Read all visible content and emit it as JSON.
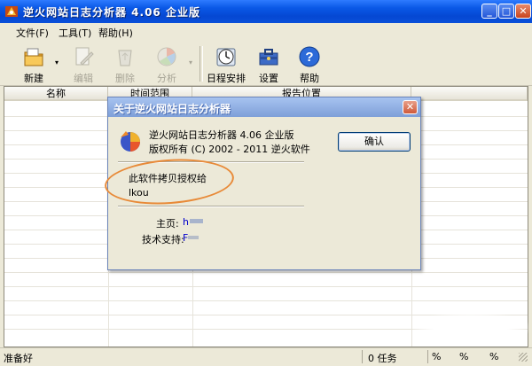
{
  "window": {
    "title": "逆火网站日志分析器 4.06 企业版",
    "min_icon": "minimize-icon",
    "max_icon": "maximize-icon",
    "close_icon": "close-icon",
    "caption_minimize": "_",
    "caption_maximize": "□",
    "caption_close": "✕"
  },
  "menu": [
    {
      "label": "文件(F)"
    },
    {
      "label": "工具(T)"
    },
    {
      "label": "帮助(H)"
    }
  ],
  "toolbar": {
    "new": "新建",
    "edit": "编辑",
    "delete": "删除",
    "analyze": "分析",
    "schedule": "日程安排",
    "settings": "设置",
    "help": "帮助",
    "help_glyph": "?"
  },
  "table": {
    "columns": [
      "名称",
      "时间范围",
      "报告位置"
    ]
  },
  "status": {
    "ready": "准备好",
    "tasks": "0 任务",
    "pct1": "%",
    "pct2": "%",
    "pct3": "%"
  },
  "dialog": {
    "title": "关于逆火网站日志分析器",
    "product": "逆火网站日志分析器 4.06 企业版",
    "copyright": "版权所有 (C) 2002 - 2011 逆火软件",
    "ok": "确认",
    "licensed_to_label": "此软件拷贝授权给",
    "licensee": "lkou",
    "homepage_label": "主页:",
    "homepage_value": "h",
    "support_label": "技术支持:",
    "support_value": "F"
  },
  "colors": {
    "titlebar": "#0a58e6",
    "dialog_title": "#7e9fd8",
    "annotation_oval": "#e88a38"
  }
}
